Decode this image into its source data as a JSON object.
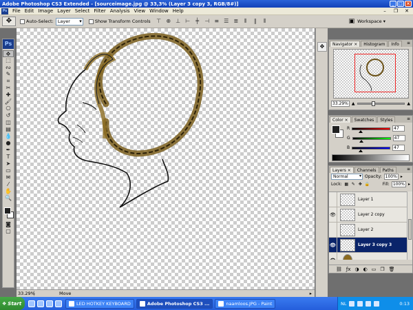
{
  "titlebar": {
    "title": "Adobe Photoshop CS3 Extended - [sourceimage.jpg @ 33,3% (Layer 3 copy 3, RGB/8#)]",
    "minimize": "_",
    "maximize": "□",
    "close": "×"
  },
  "menu": {
    "app_icon": "Ps",
    "items": [
      "File",
      "Edit",
      "Image",
      "Layer",
      "Select",
      "Filter",
      "Analysis",
      "View",
      "Window",
      "Help"
    ]
  },
  "options": {
    "auto_select_label": "Auto-Select:",
    "auto_select_value": "Layer",
    "show_transform_label": "Show Transform Controls",
    "workspace_label": "Workspace ▾"
  },
  "toolbox": {
    "logo": "Ps"
  },
  "canvas": {
    "stroke_color": "#111111",
    "hair_color": "#7a5e1c"
  },
  "statusbar": {
    "zoom": "33.29%",
    "info": "Move"
  },
  "navigator": {
    "tabs": [
      "Navigator ×",
      "Histogram",
      "Info"
    ],
    "zoom_value": "33.29%"
  },
  "color": {
    "tabs": [
      "Color ×",
      "Swatches",
      "Styles"
    ],
    "channels": [
      {
        "name": "R",
        "value": "47",
        "gradient": "linear-gradient(90deg,#000,#f00)"
      },
      {
        "name": "G",
        "value": "47",
        "gradient": "linear-gradient(90deg,#000,#0f0)"
      },
      {
        "name": "B",
        "value": "47",
        "gradient": "linear-gradient(90deg,#000,#00f)"
      }
    ]
  },
  "layers": {
    "tabs": [
      "Layers ×",
      "Channels",
      "Paths"
    ],
    "blend_mode": "Normal",
    "opacity_label": "Opacity:",
    "opacity_value": "100%",
    "lock_label": "Lock:",
    "fill_label": "Fill:",
    "fill_value": "100%",
    "items": [
      {
        "name": "Layer 1",
        "visible": false,
        "selected": false
      },
      {
        "name": "Layer 2 copy",
        "visible": true,
        "selected": false
      },
      {
        "name": "Layer 2",
        "visible": false,
        "selected": false
      },
      {
        "name": "Layer 3 copy 3",
        "visible": true,
        "selected": true
      },
      {
        "name": "",
        "visible": true,
        "selected": false
      }
    ]
  },
  "taskbar": {
    "start": "Start",
    "tasks": [
      {
        "label": "LED HOTKEY KEYBOARD",
        "active": false
      },
      {
        "label": "Adobe Photoshop CS3 ...",
        "active": true
      },
      {
        "label": "naamloos.JPG - Paint",
        "active": false
      }
    ],
    "lang": "NL",
    "clock": "0:13"
  }
}
